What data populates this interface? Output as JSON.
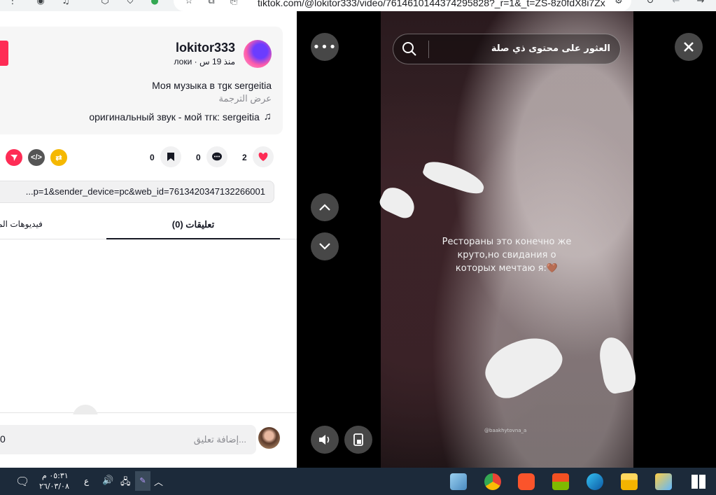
{
  "browser": {
    "url": "tiktok.com/@lokitor333/video/7614610144374295828?_r=1&_t=ZS-8z0fdX8i7Zx"
  },
  "post": {
    "username": "lokitor333",
    "meta": "локи · منذ 19 س",
    "description": "Моя музыка в тgк sergeitia",
    "translate_label": "عرض الترجمة",
    "sound": "оригинальный звук - мой тгк: sergeitia",
    "likes": "2",
    "comments": "0",
    "saves": "0",
    "link": "...p=1&sender_device=pc&web_id=7613420347132266001"
  },
  "tabs": {
    "comments": "(0) تعليقات",
    "creator_videos": "فيديوهات المبدع"
  },
  "comment_box": {
    "placeholder": "إضافة تعليق...",
    "counter": "0"
  },
  "video": {
    "search_placeholder": "العثور على محتوى ذي صلة",
    "caption_line1": "Рестораны это конечно же",
    "caption_line2": "круто,но свидания о",
    "caption_line3": "которых мечтаю я:🤎",
    "watermark": "@baakhytovna_a"
  },
  "taskbar": {
    "time": "٠٥:٣١ م",
    "date": "٢٦/٠٣/٠٨",
    "lang": "ع"
  },
  "colors": {
    "accent_red": "#fe2c55",
    "share_red": "#fe2c55",
    "embed_gray": "#555555",
    "repost_yellow": "#f5b800",
    "taskbar": "#1c2a3a"
  }
}
